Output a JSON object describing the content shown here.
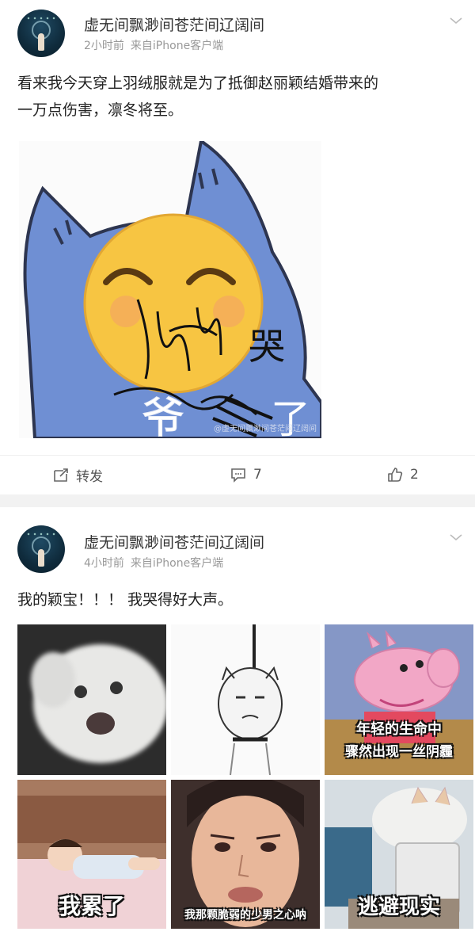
{
  "posts": [
    {
      "username": "虚无间飘渺间苍茫间辽阔间",
      "time": "2小时前",
      "source": "来自iPhone客户端",
      "text_line1": "看来我今天穿上羽绒服就是为了抵御赵丽颖结婚带来的",
      "text_line2": "一万点伤害，凛冬将至。",
      "image": {
        "caption_main": "爷",
        "caption_second": "了",
        "scribble_text": "哭",
        "watermark": "@虚无间飘渺间苍茫间辽阔间"
      },
      "actions": {
        "repost_label": "转发",
        "comment_count": "7",
        "like_count": "2"
      }
    },
    {
      "username": "虚无间飘渺间苍茫间辽阔间",
      "time": "4小时前",
      "source": "来自iPhone客户端",
      "text_line1": "我的颖宝！！！ 我哭得好大声。",
      "images": [
        {
          "caption": ""
        },
        {
          "caption": ""
        },
        {
          "caption_line1": "年轻的生命中",
          "caption_line2": "骤然出现一丝阴霾"
        },
        {
          "caption": "我累了"
        },
        {
          "caption": "我那颗脆弱的少男之心呐"
        },
        {
          "caption": "逃避现实"
        }
      ]
    }
  ],
  "colors": {
    "background": "#ffffff",
    "separator": "#f2f2f2",
    "username": "#333333",
    "meta": "#999999",
    "cat_blue": "#6f8fd3",
    "emoji_yellow": "#f7c542"
  },
  "icons": {
    "repost": "repost-icon",
    "comment": "comment-icon",
    "like": "thumbs-up-icon",
    "menu": "chevron-down-icon"
  }
}
